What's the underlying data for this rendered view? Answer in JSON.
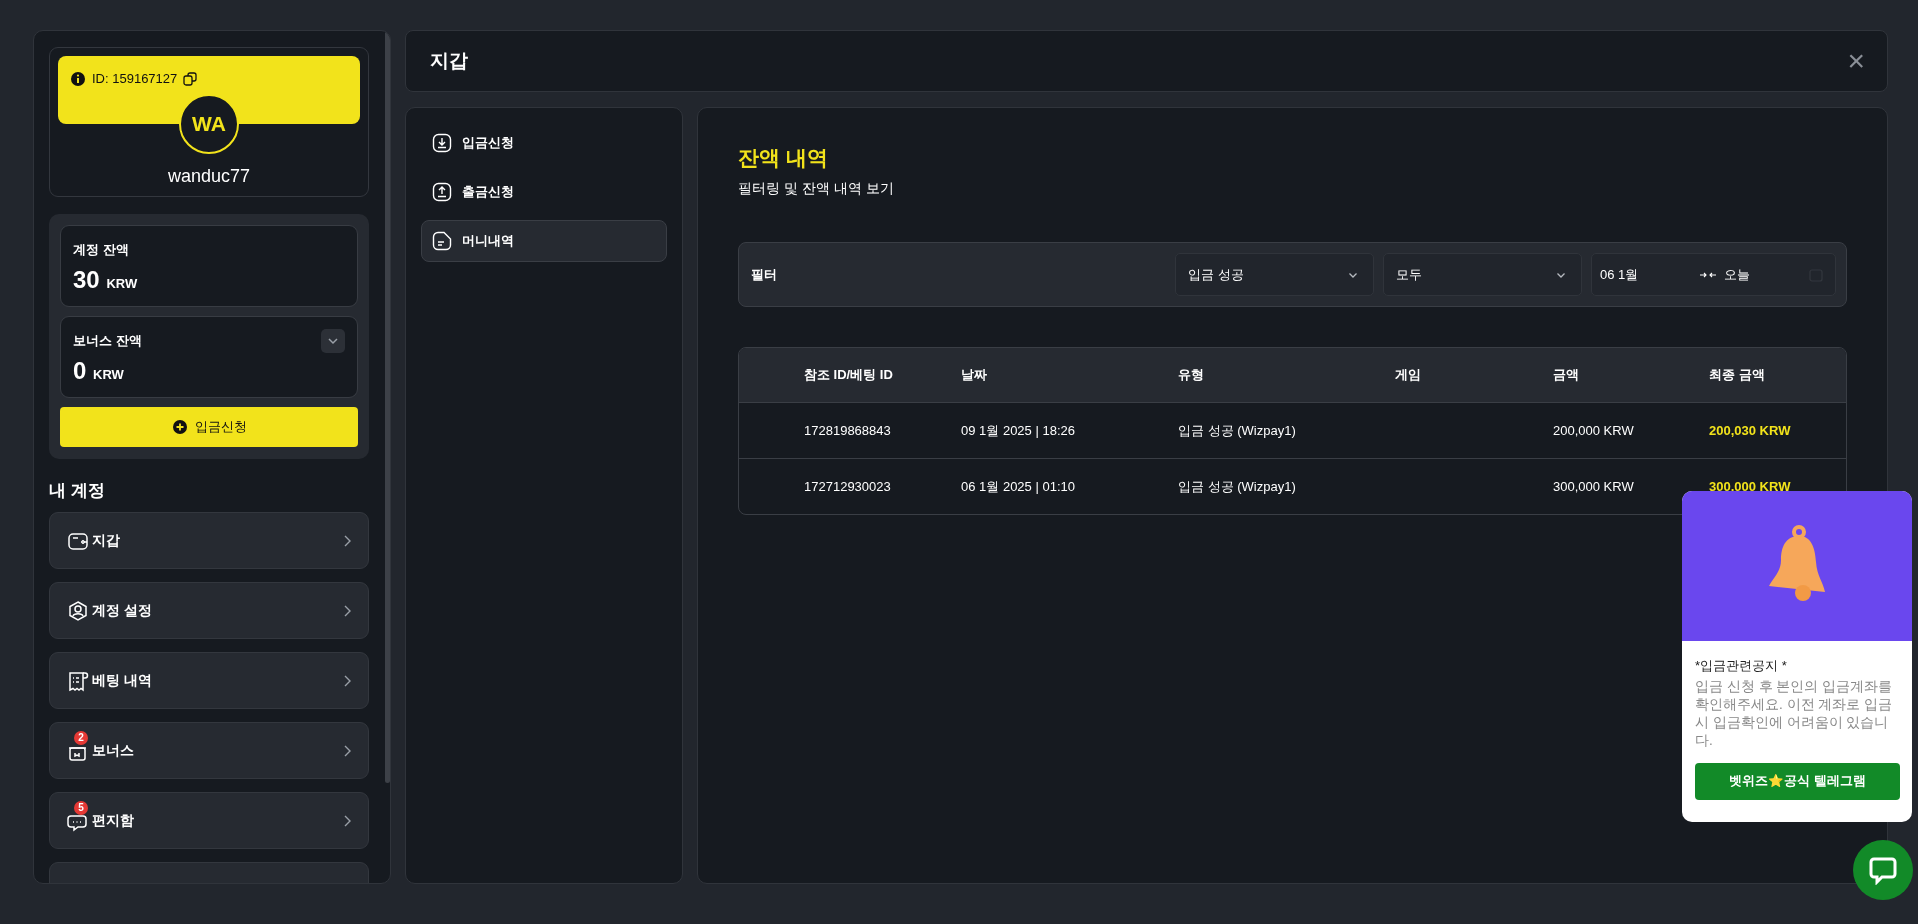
{
  "profile": {
    "id_label": "ID: 159167127",
    "initials": "WA",
    "username": "wanduc77"
  },
  "balances": [
    {
      "label": "계정 잔액",
      "amount": "30",
      "currency": "KRW",
      "expandable": false
    },
    {
      "label": "보너스 잔액",
      "amount": "0",
      "currency": "KRW",
      "expandable": true
    }
  ],
  "deposit_button": "입금신청",
  "account_section": {
    "title": "내 계정",
    "items": [
      {
        "label": "지갑"
      },
      {
        "label": "계정 설정"
      },
      {
        "label": "베팅 내역"
      },
      {
        "label": "보너스",
        "badge": "2"
      },
      {
        "label": "편지함",
        "badge": "5"
      }
    ]
  },
  "window": {
    "title": "지갑",
    "close": "×"
  },
  "wallet_nav": [
    {
      "label": "입금신청",
      "selected": false
    },
    {
      "label": "출금신청",
      "selected": false
    },
    {
      "label": "머니내역",
      "selected": true
    }
  ],
  "content": {
    "title": "잔액 내역",
    "subtitle": "필터링 및 잔액 내역 보기"
  },
  "filter": {
    "label": "필터",
    "status": "입금 성공",
    "game": "모두",
    "date_from": "06 1월",
    "date_to": "오늘"
  },
  "table": {
    "columns": [
      "참조 ID/베팅 ID",
      "날짜",
      "유형",
      "게임",
      "금액",
      "최종 금액"
    ],
    "rows": [
      [
        "172819868843",
        "09 1월 2025 | 18:26",
        "입금 성공 (Wizpay1)",
        "",
        "200,000 KRW",
        "200,030 KRW"
      ],
      [
        "172712930023",
        "06 1월 2025 | 01:10",
        "입금 성공 (Wizpay1)",
        "",
        "300,000 KRW",
        "300,000 KRW"
      ]
    ]
  },
  "notice": {
    "title": "*입금관련공지 *",
    "body": "입금 신청 후 본인의 입금계좌를 확인해주세요. 이전 계좌로 입금 시 입금확인에 어려움이 있습니다.",
    "button": "벳위즈⭐공식 텔레그램"
  }
}
